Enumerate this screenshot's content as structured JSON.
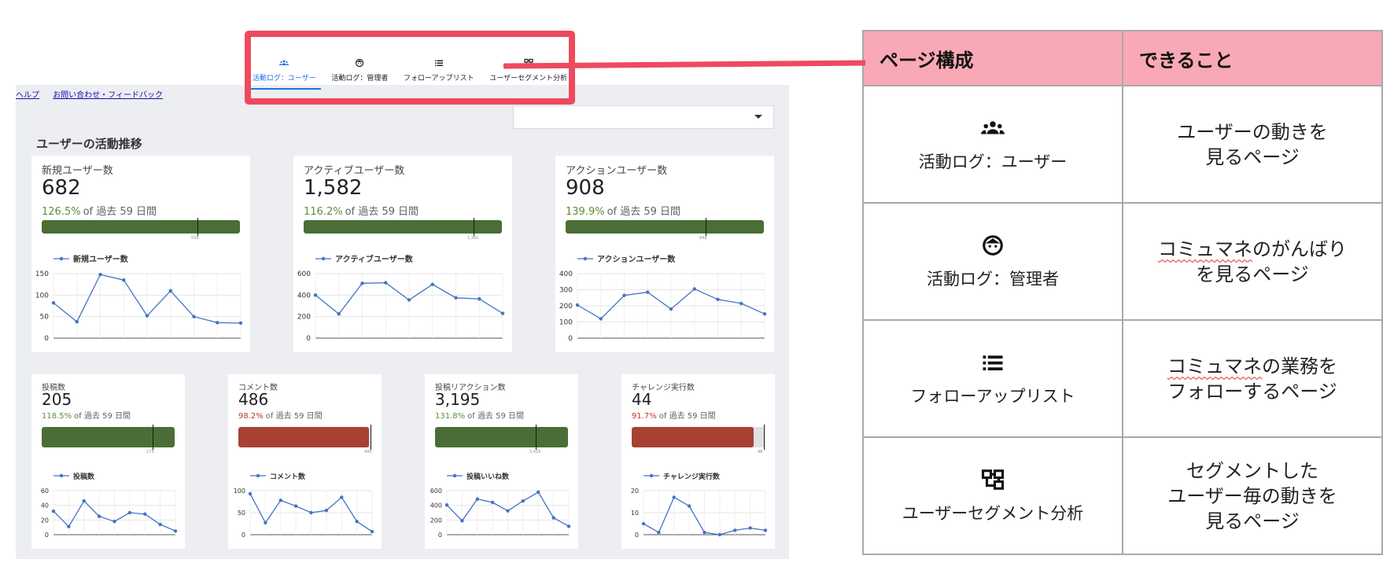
{
  "tabs": [
    {
      "label": "活動ログ：ユーザー",
      "icon": "group-icon",
      "active": true
    },
    {
      "label": "活動ログ：管理者",
      "icon": "face-icon",
      "active": false
    },
    {
      "label": "フォローアップリスト",
      "icon": "list-icon",
      "active": false
    },
    {
      "label": "ユーザーセグメント分析",
      "icon": "segment-icon",
      "active": false
    }
  ],
  "links": {
    "help": "ヘルプ",
    "feedback": "お問い合わせ・フィードバック"
  },
  "section_title": "ユーザーの活動推移",
  "compare_suffix": "of 過去 59 日間",
  "colors": {
    "highlight": "#ee4a5f",
    "positive": "#4a6e35",
    "negative": "#a84132",
    "line": "#4472c4",
    "table_header": "#f9a9b5"
  },
  "scorecards": [
    {
      "label": "新規ユーザー数",
      "value": "682",
      "pct": "126.5%",
      "trend": "positive",
      "target_label": "539",
      "fill_fraction": 1.0,
      "target_fraction": 0.79
    },
    {
      "label": "アクティブユーザー数",
      "value": "1,582",
      "pct": "116.2%",
      "trend": "positive",
      "target_label": "1,361",
      "fill_fraction": 1.0,
      "target_fraction": 0.86
    },
    {
      "label": "アクションユーザー数",
      "value": "908",
      "pct": "139.9%",
      "trend": "positive",
      "target_label": "649",
      "fill_fraction": 1.0,
      "target_fraction": 0.71
    },
    {
      "label": "投稿数",
      "value": "205",
      "pct": "118.5%",
      "trend": "positive",
      "target_label": "173",
      "fill_fraction": 1.0,
      "target_fraction": 0.84
    },
    {
      "label": "コメント数",
      "value": "486",
      "pct": "98.2%",
      "trend": "negative",
      "target_label": "495",
      "fill_fraction": 0.982,
      "target_fraction": 1.0
    },
    {
      "label": "投稿リアクション数",
      "value": "3,195",
      "pct": "131.8%",
      "trend": "positive",
      "target_label": "2,425",
      "fill_fraction": 1.0,
      "target_fraction": 0.76
    },
    {
      "label": "チャレンジ実行数",
      "value": "44",
      "pct": "91.7%",
      "trend": "negative",
      "target_label": "48",
      "fill_fraction": 0.917,
      "target_fraction": 1.0
    }
  ],
  "chart_data": [
    {
      "type": "line",
      "series": [
        {
          "name": "新規ユーザー数",
          "values": [
            82,
            38,
            148,
            135,
            52,
            110,
            50,
            36,
            35
          ]
        }
      ],
      "ylim": [
        0,
        150
      ],
      "yticks": [
        "0",
        "50",
        "100",
        "150"
      ],
      "grid": true,
      "legend": "top-left"
    },
    {
      "type": "line",
      "series": [
        {
          "name": "アクティブユーザー数",
          "values": [
            400,
            225,
            510,
            515,
            355,
            500,
            375,
            365,
            230
          ]
        }
      ],
      "ylim": [
        0,
        600
      ],
      "yticks": [
        "0",
        "200",
        "400",
        "600"
      ],
      "grid": true,
      "legend": "top-left"
    },
    {
      "type": "line",
      "series": [
        {
          "name": "アクションユーザー数",
          "values": [
            205,
            120,
            265,
            285,
            180,
            305,
            240,
            215,
            150
          ]
        }
      ],
      "ylim": [
        0,
        400
      ],
      "yticks": [
        "0",
        "100",
        "200",
        "300",
        "400"
      ],
      "grid": true,
      "legend": "top-left"
    },
    {
      "type": "line",
      "series": [
        {
          "name": "投稿数",
          "values": [
            32,
            11,
            46,
            25,
            18,
            30,
            28,
            14,
            5
          ]
        }
      ],
      "ylim": [
        0,
        60
      ],
      "yticks": [
        "0",
        "20",
        "40",
        "60"
      ],
      "grid": true,
      "legend": "top-left"
    },
    {
      "type": "line",
      "series": [
        {
          "name": "コメント数",
          "values": [
            93,
            27,
            78,
            65,
            50,
            55,
            85,
            30,
            7
          ]
        }
      ],
      "ylim": [
        0,
        100
      ],
      "yticks": [
        "0",
        "50",
        "100"
      ],
      "grid": true,
      "legend": "top-left"
    },
    {
      "type": "line",
      "series": [
        {
          "name": "投稿いいね数",
          "values": [
            405,
            190,
            485,
            440,
            325,
            460,
            580,
            230,
            115
          ]
        }
      ],
      "ylim": [
        0,
        600
      ],
      "yticks": [
        "0",
        "200",
        "400",
        "600"
      ],
      "grid": true,
      "legend": "top-left"
    },
    {
      "type": "line",
      "series": [
        {
          "name": "チャレンジ実行数",
          "values": [
            5,
            1,
            17,
            13,
            1,
            0,
            2,
            3,
            2
          ]
        }
      ],
      "ylim": [
        0,
        20
      ],
      "yticks": [
        "0",
        "10",
        "20"
      ],
      "grid": true,
      "legend": "top-left"
    }
  ],
  "table": {
    "headers": [
      "ページ構成",
      "できること"
    ],
    "rows": [
      {
        "icon": "group-icon",
        "page": "活動ログ：ユーザー",
        "can_lines": [
          "ユーザーの動きを",
          "見るページ"
        ]
      },
      {
        "icon": "face-icon",
        "page": "活動ログ：管理者",
        "can_wavy": "コミュマネ",
        "can_lines": [
          "のがんばり",
          "を見るページ"
        ]
      },
      {
        "icon": "list-icon",
        "page": "フォローアップリスト",
        "can_wavy": "コミュマネ",
        "can_lines": [
          "の業務を",
          "フォローするページ"
        ]
      },
      {
        "icon": "segment-icon",
        "page": "ユーザーセグメント分析",
        "can_lines": [
          "セグメントした",
          "ユーザー毎の動きを",
          "見るページ"
        ]
      }
    ]
  }
}
